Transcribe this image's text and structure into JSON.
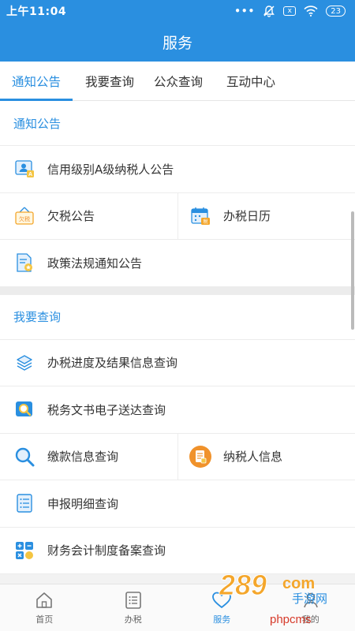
{
  "status": {
    "time": "上午11:04",
    "dots": "•••",
    "box": "x",
    "battery": "23"
  },
  "header": {
    "title": "服务"
  },
  "tabs": [
    {
      "label": "通知公告"
    },
    {
      "label": "我要查询"
    },
    {
      "label": "公众查询"
    },
    {
      "label": "互动中心"
    }
  ],
  "sections": {
    "notice": {
      "title": "通知公告",
      "items": [
        {
          "label": "信用级别A级纳税人公告",
          "icon": "credit-badge-icon"
        },
        {
          "label": "欠税公告",
          "icon": "tax-owed-sign-icon"
        },
        {
          "label": "办税日历",
          "icon": "tax-calendar-icon"
        },
        {
          "label": "政策法规通知公告",
          "icon": "policy-document-icon"
        }
      ]
    },
    "query": {
      "title": "我要查询",
      "items": [
        {
          "label": "办税进度及结果信息查询",
          "icon": "layers-icon"
        },
        {
          "label": "税务文书电子送达查询",
          "icon": "document-search-icon"
        },
        {
          "label": "缴款信息查询",
          "icon": "magnifier-icon"
        },
        {
          "label": "纳税人信息",
          "icon": "taxpayer-info-icon"
        },
        {
          "label": "申报明细查询",
          "icon": "list-document-icon"
        },
        {
          "label": "财务会计制度备案查询",
          "icon": "calculator-icon"
        }
      ]
    }
  },
  "nav": [
    {
      "label": "首页",
      "icon": "home-icon"
    },
    {
      "label": "办税",
      "icon": "list-icon"
    },
    {
      "label": "服务",
      "icon": "heart-icon"
    },
    {
      "label": "我的",
      "icon": "user-icon"
    }
  ],
  "watermark": {
    "brand": "289",
    "suffix": "com",
    "sub": "手游网",
    "site": "phpcms"
  },
  "colors": {
    "primary": "#2a8fe0",
    "orange": "#f0922b",
    "yellow": "#f4c542"
  }
}
